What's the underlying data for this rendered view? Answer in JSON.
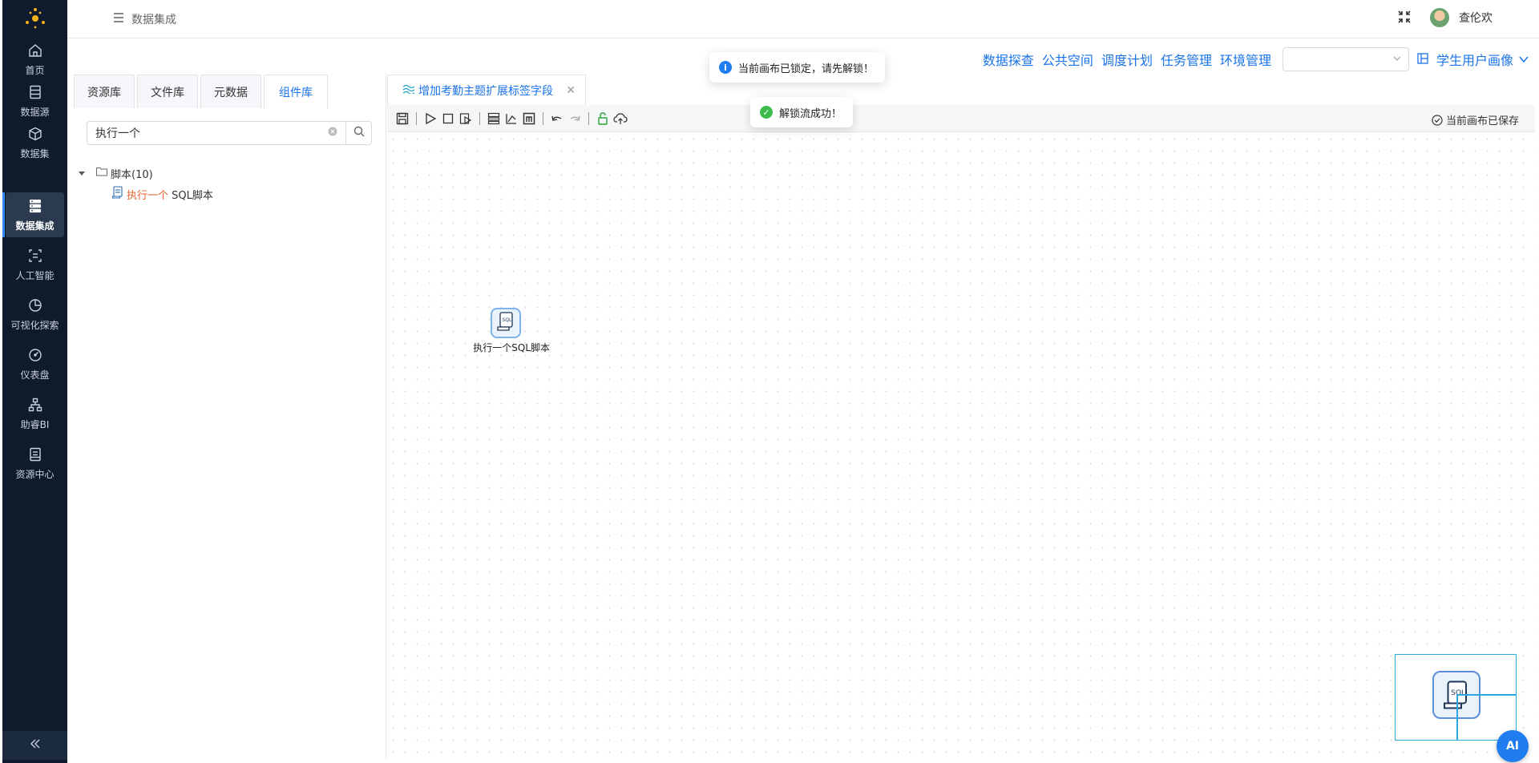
{
  "colors": {
    "sidebar_bg": "#0f1b2d",
    "accent": "#1a73e8",
    "highlight": "#e6612e",
    "success": "#3cbc4a"
  },
  "sidebar": {
    "items": [
      {
        "label": "首页",
        "icon": "home-icon"
      },
      {
        "label": "数据源",
        "icon": "database-icon"
      },
      {
        "label": "数据集",
        "icon": "cube-icon"
      },
      {
        "label": "数据集成",
        "icon": "server-icon",
        "active": true
      },
      {
        "label": "人工智能",
        "icon": "ai-scan-icon"
      },
      {
        "label": "可视化探索",
        "icon": "pie-chart-icon"
      },
      {
        "label": "仪表盘",
        "icon": "gauge-icon"
      },
      {
        "label": "助睿BI",
        "icon": "org-chart-icon"
      },
      {
        "label": "资源中心",
        "icon": "resource-icon"
      }
    ]
  },
  "header": {
    "breadcrumb": "数据集成",
    "username": "查伦欢"
  },
  "links": {
    "explore": "数据探查",
    "public_space": "公共空间",
    "schedule": "调度计划",
    "tasks": "任务管理",
    "env": "环境管理",
    "project": "学生用户画像"
  },
  "left_panel": {
    "tabs": [
      "资源库",
      "文件库",
      "元数据",
      "组件库"
    ],
    "active_tab": "组件库",
    "search_value": "执行一个",
    "tree": {
      "folder": "脚本(10)",
      "child_highlight": "执行一个",
      "child_rest": " SQL脚本"
    }
  },
  "editor": {
    "tab_title": "增加考勤主题扩展标签字段",
    "saved_status": "当前画布已保存",
    "node_label": "执行一个SQL脚本",
    "node_icon_text": "SQL",
    "ai_button": "AI"
  },
  "toasts": {
    "info": "当前画布已锁定，请先解锁！",
    "success": "解锁流成功！"
  }
}
